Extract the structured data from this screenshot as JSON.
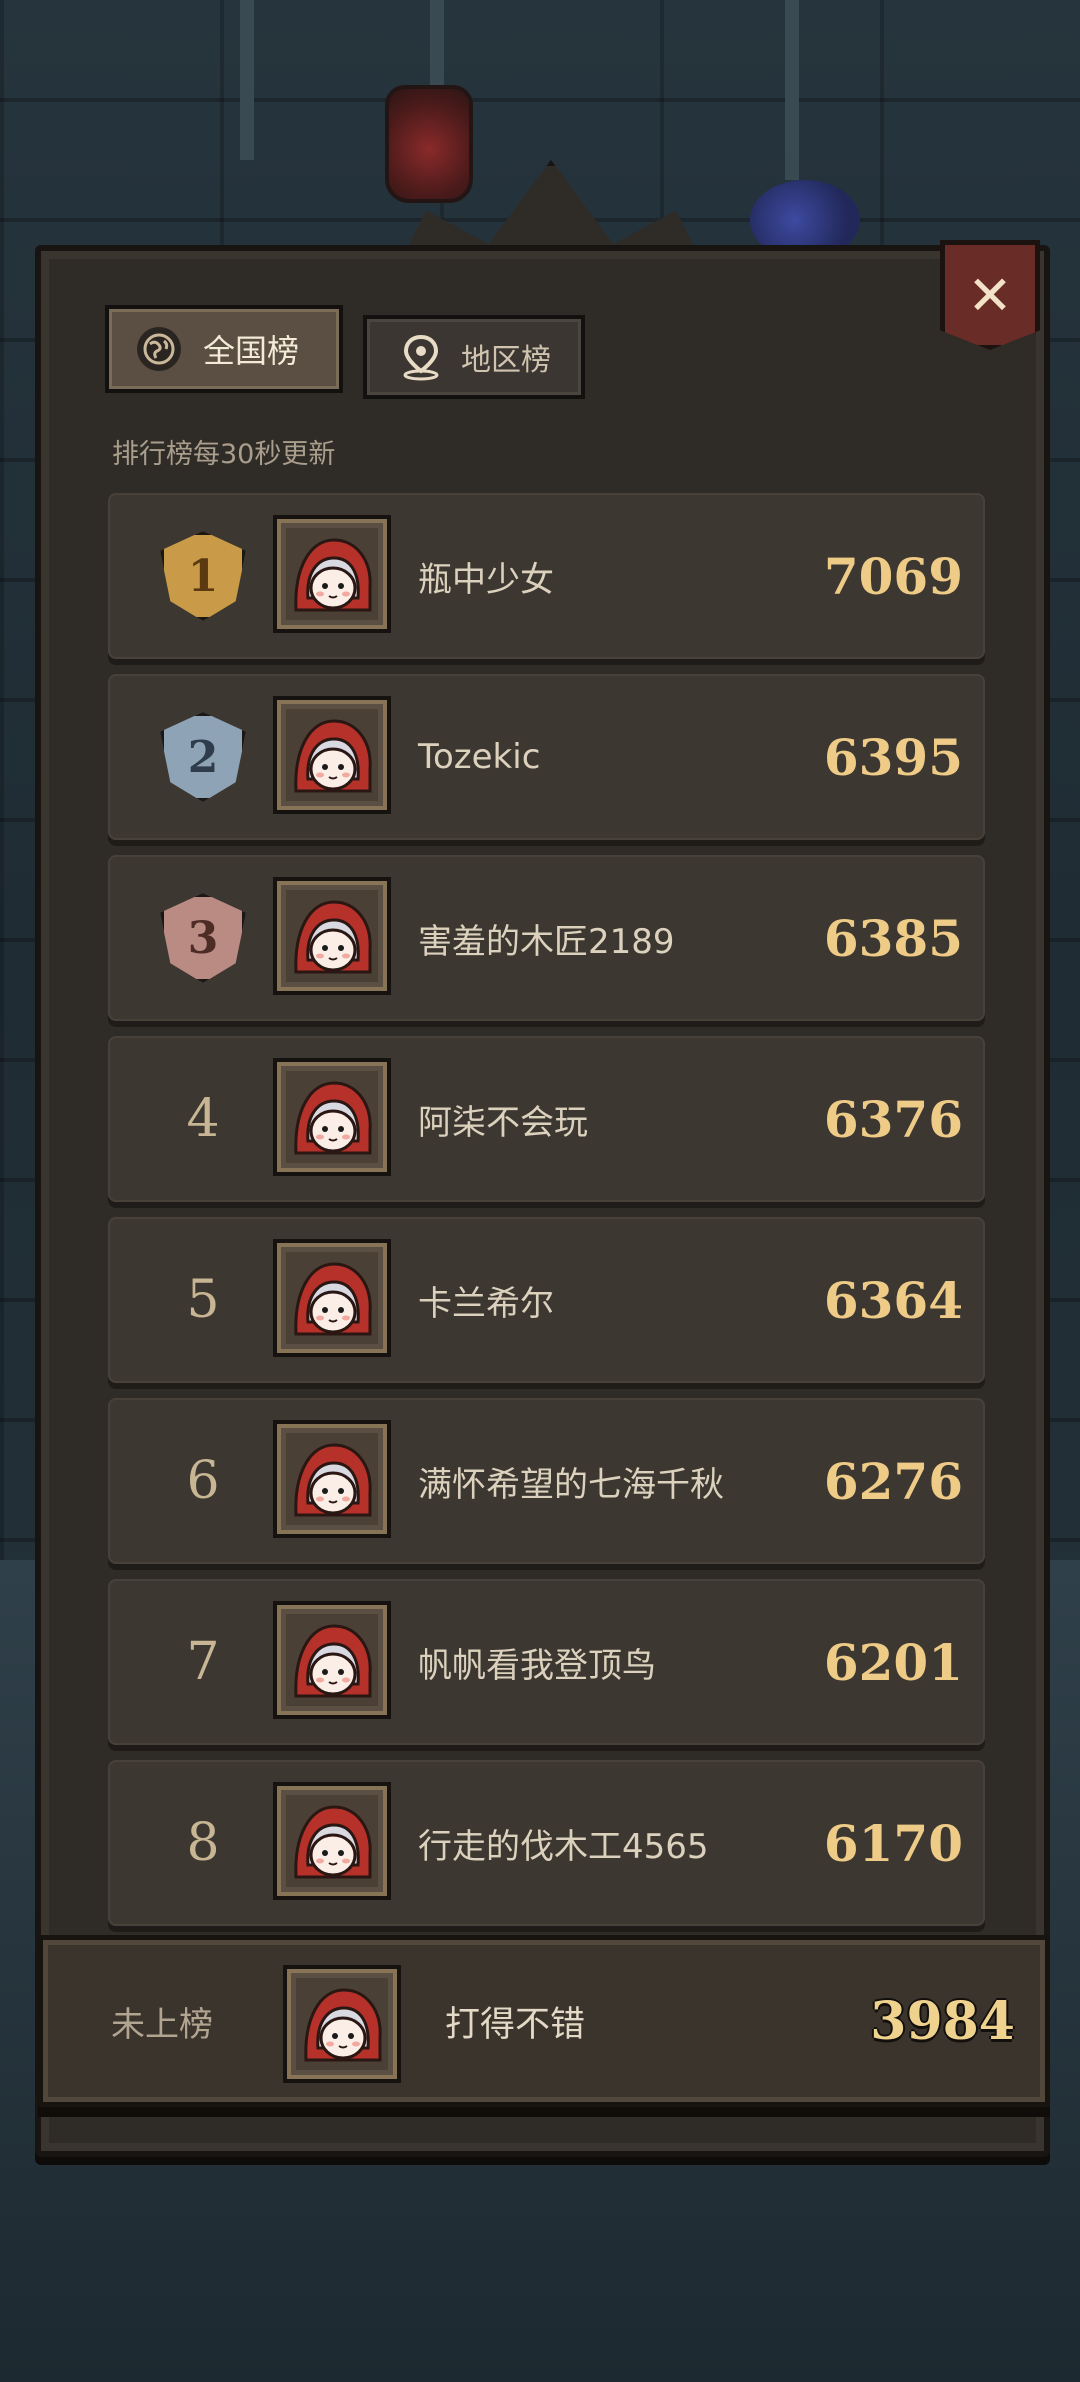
{
  "tabs": {
    "national": {
      "label": "全国榜",
      "icon": "globe-icon",
      "active": true
    },
    "regional": {
      "label": "地区榜",
      "icon": "location-pin-icon",
      "active": false
    }
  },
  "update_note": "排行榜每30秒更新",
  "leaderboard": [
    {
      "rank": "1",
      "medal": "gold",
      "name": "瓶中少女",
      "score": "7069"
    },
    {
      "rank": "2",
      "medal": "silver",
      "name": "Tozekic",
      "score": "6395"
    },
    {
      "rank": "3",
      "medal": "bronze",
      "name": "害羞的木匠2189",
      "score": "6385"
    },
    {
      "rank": "4",
      "name": "阿柒不会玩",
      "score": "6376"
    },
    {
      "rank": "5",
      "name": "卡兰希尔",
      "score": "6364"
    },
    {
      "rank": "6",
      "name": "满怀希望的七海千秋",
      "score": "6276"
    },
    {
      "rank": "7",
      "name": "帆帆看我登顶鸟",
      "score": "6201"
    },
    {
      "rank": "8",
      "name": "行走的伐木工4565",
      "score": "6170"
    }
  ],
  "self": {
    "status": "未上榜",
    "name": "打得不错",
    "score": "3984"
  },
  "colors": {
    "panel": "#2f2b27",
    "row": "#3c3731",
    "score": "#eecb87",
    "gold": "#c99a47",
    "silver": "#8fa3b7",
    "bronze": "#b98b82"
  }
}
